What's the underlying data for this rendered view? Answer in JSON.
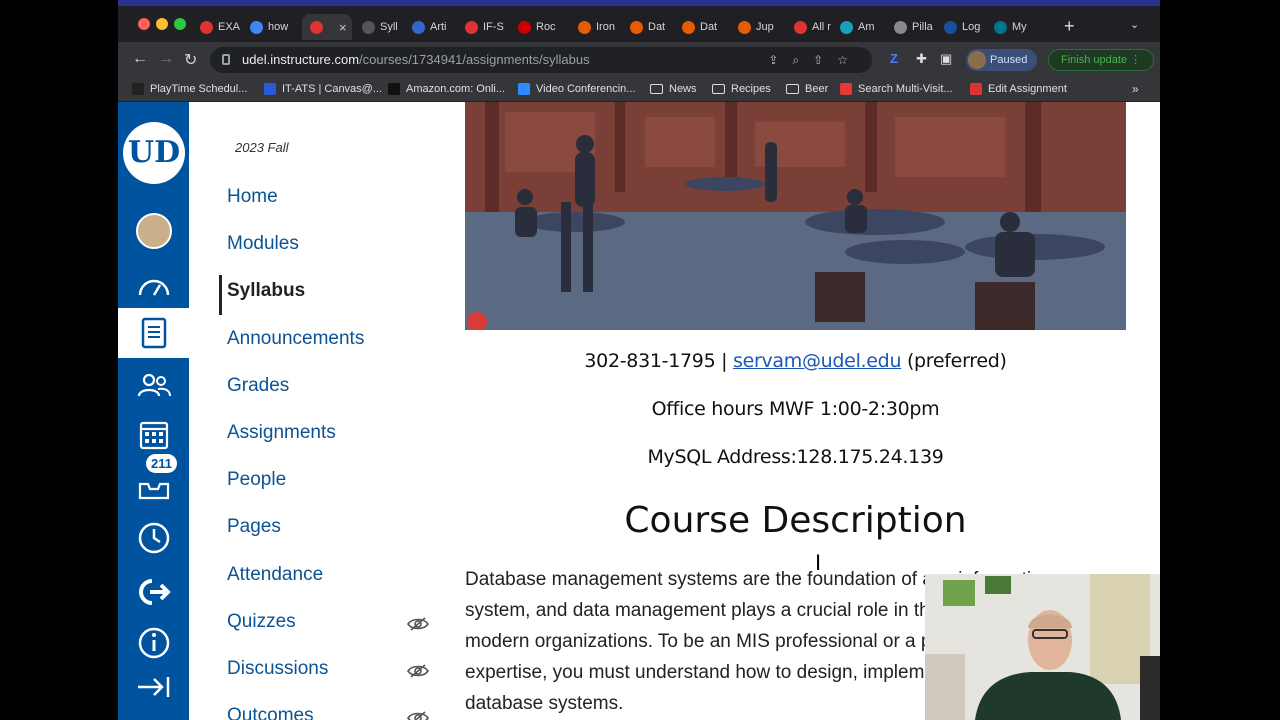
{
  "browser": {
    "tabs": [
      {
        "label": "EXA",
        "fav": "#d33"
      },
      {
        "label": "how",
        "fav": "#4285f4"
      },
      {
        "label": "",
        "fav": "#d33",
        "active": true
      },
      {
        "label": "Syll",
        "fav": "#555"
      },
      {
        "label": "Arti",
        "fav": "#3366cc"
      },
      {
        "label": "IF-S",
        "fav": "#d33"
      },
      {
        "label": "Roc",
        "fav": "#c00"
      },
      {
        "label": "Iron",
        "fav": "#e65c00"
      },
      {
        "label": "Dat",
        "fav": "#e65c00"
      },
      {
        "label": "Dat",
        "fav": "#e65c00"
      },
      {
        "label": "Jup",
        "fav": "#e65c00"
      },
      {
        "label": "All r",
        "fav": "#d33"
      },
      {
        "label": "Am",
        "fav": "#17a2b8"
      },
      {
        "label": "Pilla",
        "fav": "#888"
      },
      {
        "label": "Log",
        "fav": "#1a4fa0"
      },
      {
        "label": "My",
        "fav": "#00758f"
      }
    ],
    "close_label": "×",
    "newtab_label": "+",
    "tab_menu_label": "⌄",
    "url_host": "udel.instructure.com",
    "url_path": "/courses/1734941/assignments/syllabus",
    "profile_label": "Paused",
    "update_label": "Finish update",
    "bookmarks": [
      {
        "label": "PlayTime Schedul...",
        "icon": "#222"
      },
      {
        "label": "IT-ATS | Canvas@...",
        "icon": "#2a5bd7"
      },
      {
        "label": "Amazon.com: Onli...",
        "icon": "#111"
      },
      {
        "label": "Video Conferencin...",
        "icon": "#2d8cff"
      },
      {
        "label": "News",
        "icon": "folder"
      },
      {
        "label": "Recipes",
        "icon": "folder"
      },
      {
        "label": "Beer",
        "icon": "folder"
      },
      {
        "label": "Search Multi-Visit...",
        "icon": "#e53935"
      },
      {
        "label": "Edit Assignment",
        "icon": "#d33"
      }
    ],
    "bookmarks_more": "»"
  },
  "canvas": {
    "logo_text": "UD",
    "badge_count": "211",
    "term": "2023 Fall",
    "course_nav": [
      {
        "label": "Home"
      },
      {
        "label": "Modules"
      },
      {
        "label": "Syllabus",
        "active": true
      },
      {
        "label": "Announcements"
      },
      {
        "label": "Grades"
      },
      {
        "label": "Assignments"
      },
      {
        "label": "People"
      },
      {
        "label": "Pages"
      },
      {
        "label": "Attendance"
      },
      {
        "label": "Quizzes",
        "hidden": true
      },
      {
        "label": "Discussions",
        "hidden": true
      },
      {
        "label": "Outcomes",
        "hidden": true
      }
    ]
  },
  "syllabus": {
    "phone": "302-831-1795",
    "separator": "|",
    "email": "servam@udel.edu",
    "email_note": "(preferred)",
    "office_hours": "Office hours MWF 1:00-2:30pm",
    "mysql_label": "MySQL Address:",
    "mysql_value": "128.175.24.139",
    "heading": "Course Description",
    "description": "Database management systems are the foundation of any information system, and data management plays a crucial role in the operation of all modern organizations. To be an MIS professional or a professional with MIS expertise, you must understand how to design, implement, and manage database systems."
  },
  "colors": {
    "canvas_blue": "#00539f",
    "link_blue": "#0b5394"
  }
}
